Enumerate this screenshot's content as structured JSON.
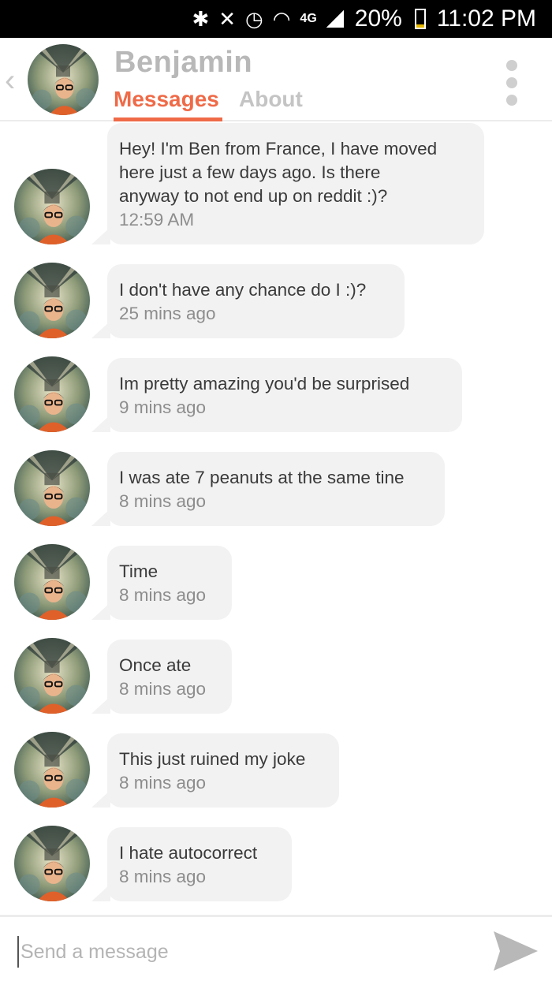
{
  "status_bar": {
    "icons": [
      "bluetooth-icon",
      "mute-icon",
      "alarm-icon",
      "wifi-icon",
      "4g-icon",
      "signal-icon"
    ],
    "network": "4G",
    "battery_percent": "20%",
    "battery_level": 0.2,
    "time": "11:02 PM"
  },
  "header": {
    "back_icon": "‹",
    "name": "Benjamin",
    "tabs": [
      {
        "label": "Messages",
        "active": true
      },
      {
        "label": "About",
        "active": false
      }
    ],
    "accent_color": "#ef6a47"
  },
  "messages": [
    {
      "lines": [
        "Hey! I'm Ben from France, I have moved",
        "here just a few days ago. Is there",
        "anyway to not end up on reddit :)?"
      ],
      "time": "12:59 AM"
    },
    {
      "lines": [
        "I don't have any chance do I :)?"
      ],
      "time": "25 mins ago"
    },
    {
      "lines": [
        "Im pretty amazing you'd be surprised"
      ],
      "time": "9 mins ago"
    },
    {
      "lines": [
        "I was ate 7 peanuts at the same tine"
      ],
      "time": "8 mins ago"
    },
    {
      "lines": [
        "Time"
      ],
      "time": "8 mins ago"
    },
    {
      "lines": [
        "Once ate"
      ],
      "time": "8 mins ago"
    },
    {
      "lines": [
        "This just ruined my joke"
      ],
      "time": "8 mins ago"
    },
    {
      "lines": [
        "I hate autocorrect"
      ],
      "time": "8 mins ago"
    }
  ],
  "composer": {
    "placeholder": "Send a message",
    "value": ""
  }
}
